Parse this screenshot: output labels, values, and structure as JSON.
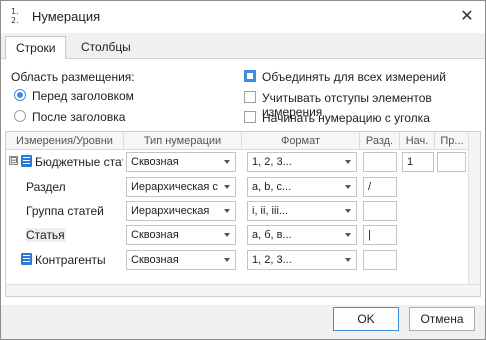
{
  "window": {
    "title": "Нумерация",
    "icon_glyph": "1.\n2."
  },
  "tabs": [
    {
      "label": "Строки"
    },
    {
      "label": "Столбцы"
    }
  ],
  "placement": {
    "heading": "Область размещения:",
    "options": [
      {
        "label": "Перед заголовком",
        "checked": true
      },
      {
        "label": "После заголовка",
        "checked": false
      }
    ]
  },
  "options": [
    {
      "label": "Объединять для всех измерений",
      "checked": true
    },
    {
      "label": "Учитывать отступы элементов измерения",
      "checked": false
    },
    {
      "label": "Начинать нумерацию с уголка",
      "checked": false
    }
  ],
  "grid": {
    "columns": [
      "Измерения/Уровни",
      "Тип нумерации",
      "Формат",
      "Разд.",
      "Нач.",
      "Пр..."
    ],
    "rows": [
      {
        "name": "Бюджетные стат",
        "type": "Сквозная",
        "format": "1, 2, 3...",
        "sep": "",
        "start": "1",
        "extra": "",
        "icon": "dimension-icon",
        "expander": "⊟"
      },
      {
        "name": "Раздел",
        "type": "Иерархическая с",
        "format": "a, b, c...",
        "sep": "/",
        "start": "",
        "extra": ""
      },
      {
        "name": "Группа статей",
        "type": "Иерархическая",
        "format": "i, ii, iii...",
        "sep": "",
        "start": "",
        "extra": ""
      },
      {
        "name": "Статья",
        "type": "Сквозная",
        "format": "а, б, в...",
        "sep": "|",
        "start": "",
        "extra": ""
      },
      {
        "name": "Контрагенты",
        "type": "Сквозная",
        "format": "1, 2, 3...",
        "sep": "",
        "start": "",
        "extra": "",
        "icon": "dimension-icon"
      }
    ]
  },
  "buttons": {
    "ok": "OK",
    "cancel": "Отмена"
  },
  "colors": {
    "accent": "#3d8ee0",
    "icon_blue": "#2b7bd6"
  }
}
